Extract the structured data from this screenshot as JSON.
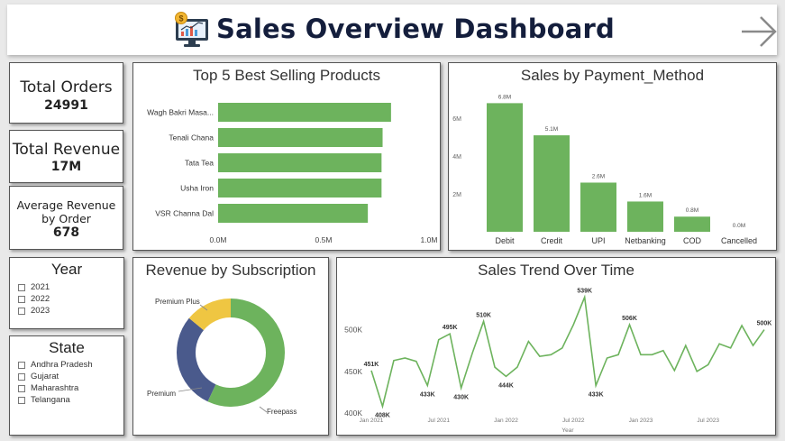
{
  "header": {
    "title": "Sales Overview Dashboard",
    "logo_icon": "dashboard-monitor-icon",
    "nav_icon": "arrow-right-icon"
  },
  "kpis": {
    "total_orders": {
      "label": "Total Orders",
      "value": "24991"
    },
    "total_revenue": {
      "label": "Total Revenue",
      "value": "17M"
    },
    "avg_revenue": {
      "label_line1": "Average Revenue",
      "label_line2": "by Order",
      "value": "678"
    }
  },
  "filters": {
    "year": {
      "title": "Year",
      "options": [
        "2021",
        "2022",
        "2023"
      ]
    },
    "state": {
      "title": "State",
      "options": [
        "Andhra Pradesh",
        "Gujarat",
        "Maharashtra",
        "Telangana"
      ]
    }
  },
  "colors": {
    "green": "#6db35d",
    "navy": "#4a5a8c",
    "yellow": "#efc642"
  },
  "chart_data": [
    {
      "id": "top_products",
      "type": "bar",
      "orientation": "horizontal",
      "title": "Top 5 Best Selling Products",
      "categories": [
        "Wagh Bakri Masa...",
        "Tenali Chana",
        "Tata Tea",
        "Usha Iron",
        "VSR Channa Dal"
      ],
      "values": [
        0.82,
        0.78,
        0.775,
        0.775,
        0.71
      ],
      "xlim": [
        0,
        1
      ],
      "xticks": [
        0,
        0.5,
        1
      ],
      "xtick_labels": [
        "0.0M",
        "0.5M",
        "1.0M"
      ]
    },
    {
      "id": "payment_method",
      "type": "bar",
      "title": "Sales by Payment_Method",
      "categories": [
        "Debit",
        "Credit",
        "UPI",
        "Netbanking",
        "COD",
        "Cancelled"
      ],
      "values": [
        6.8,
        5.1,
        2.6,
        1.6,
        0.8,
        0.0
      ],
      "data_labels": [
        "6.8M",
        "5.1M",
        "2.6M",
        "1.6M",
        "0.8M",
        "0.0M"
      ],
      "ylim": [
        0,
        7.2
      ],
      "yticks": [
        2,
        4,
        6
      ],
      "ytick_labels": [
        "2M",
        "4M",
        "6M"
      ]
    },
    {
      "id": "subscription",
      "type": "pie",
      "donut": true,
      "title": "Revenue by Subscription",
      "labels": [
        "Freepass",
        "Premium",
        "Premium Plus"
      ],
      "values": [
        57,
        29,
        14
      ]
    },
    {
      "id": "sales_trend",
      "type": "line",
      "title": "Sales Trend Over Time",
      "xlabel": "Year",
      "x": [
        "2021-01",
        "2021-02",
        "2021-03",
        "2021-04",
        "2021-05",
        "2021-06",
        "2021-07",
        "2021-08",
        "2021-09",
        "2021-10",
        "2021-11",
        "2021-12",
        "2022-01",
        "2022-02",
        "2022-03",
        "2022-04",
        "2022-05",
        "2022-06",
        "2022-07",
        "2022-08",
        "2022-09",
        "2022-10",
        "2022-11",
        "2022-12",
        "2023-01",
        "2023-02",
        "2023-03",
        "2023-04",
        "2023-05",
        "2023-06",
        "2023-07",
        "2023-08",
        "2023-09",
        "2023-10",
        "2023-11",
        "2023-12"
      ],
      "y": [
        451,
        408,
        463,
        466,
        462,
        433,
        488,
        495,
        430,
        472,
        510,
        455,
        444,
        455,
        486,
        468,
        470,
        478,
        506,
        539,
        433,
        466,
        470,
        506,
        470,
        470,
        475,
        451,
        481,
        450,
        458,
        483,
        478,
        505,
        481,
        500
      ],
      "data_labels": [
        {
          "index": 0,
          "text": "451K"
        },
        {
          "index": 1,
          "text": "408K"
        },
        {
          "index": 5,
          "text": "433K"
        },
        {
          "index": 7,
          "text": "495K"
        },
        {
          "index": 8,
          "text": "430K"
        },
        {
          "index": 10,
          "text": "510K"
        },
        {
          "index": 12,
          "text": "444K"
        },
        {
          "index": 19,
          "text": "539K"
        },
        {
          "index": 20,
          "text": "433K"
        },
        {
          "index": 23,
          "text": "506K"
        },
        {
          "index": 35,
          "text": "500K"
        }
      ],
      "ylim": [
        400,
        545
      ],
      "yticks": [
        400,
        450,
        500
      ],
      "ytick_labels": [
        "400K",
        "450K",
        "500K"
      ],
      "xticks": [
        0,
        6,
        12,
        18,
        24,
        30
      ],
      "xtick_labels": [
        "Jan 2021",
        "Jul 2021",
        "Jan 2022",
        "Jul 2022",
        "Jan 2023",
        "Jul 2023"
      ]
    }
  ]
}
